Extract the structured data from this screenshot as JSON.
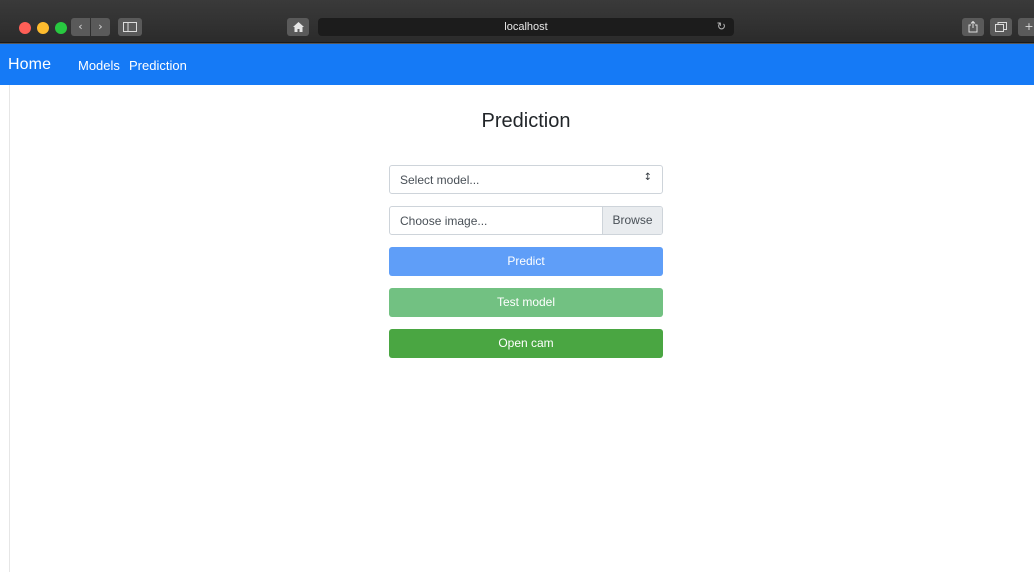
{
  "browser": {
    "address": "localhost",
    "icons": {
      "back": "chevron-left-icon",
      "forward": "chevron-right-icon",
      "sidebar": "sidebar-icon",
      "home": "home-icon",
      "reload": "reload-icon",
      "share": "share-icon",
      "tabs": "tabs-icon",
      "new_tab": "plus-icon"
    },
    "colors": {
      "close": "#fe5f57",
      "minimize": "#febc2e",
      "zoom": "#28c840"
    }
  },
  "navbar": {
    "brand": "Home",
    "links": [
      {
        "label": "Models"
      },
      {
        "label": "Prediction"
      }
    ],
    "color": "#157af6"
  },
  "main": {
    "title": "Prediction",
    "model_select": {
      "value": "Select model..."
    },
    "image_input": {
      "placeholder": "Choose image...",
      "browse_label": "Browse"
    },
    "buttons": {
      "predict": "Predict",
      "test_model": "Test model",
      "open_cam": "Open cam"
    },
    "colors": {
      "predict": "#5f9ef8",
      "test_model": "#72c182",
      "open_cam": "#4aa642"
    }
  }
}
